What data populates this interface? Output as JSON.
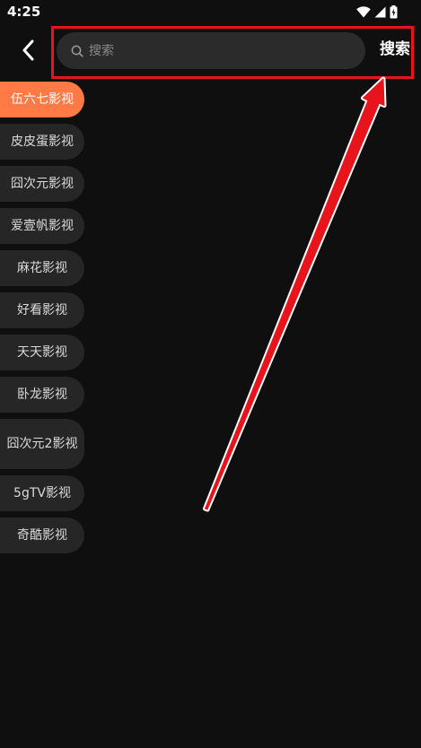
{
  "status_bar": {
    "time": "4:25",
    "icons": [
      "wifi-icon",
      "signal-icon",
      "battery-icon"
    ]
  },
  "header": {
    "back_icon": "chevron-left-icon",
    "search_placeholder": "搜索",
    "search_value": "",
    "search_button": "搜索"
  },
  "sources": [
    {
      "label": "伍六七影视",
      "active": true
    },
    {
      "label": "皮皮蛋影视",
      "active": false
    },
    {
      "label": "囧次元影视",
      "active": false
    },
    {
      "label": "爱壹帆影视",
      "active": false
    },
    {
      "label": "麻花影视",
      "active": false
    },
    {
      "label": "好看影视",
      "active": false
    },
    {
      "label": "天天影视",
      "active": false
    },
    {
      "label": "卧龙影视",
      "active": false
    },
    {
      "label": "囧次元2影视",
      "active": false
    },
    {
      "label": "5gTV影视",
      "active": false
    },
    {
      "label": "奇酷影视",
      "active": false
    }
  ],
  "colors": {
    "background": "#0f0f0f",
    "accent": "#ff7a45",
    "item_bg": "#262626",
    "search_bg": "#2b2b2b",
    "annotation": "#e8141c"
  }
}
